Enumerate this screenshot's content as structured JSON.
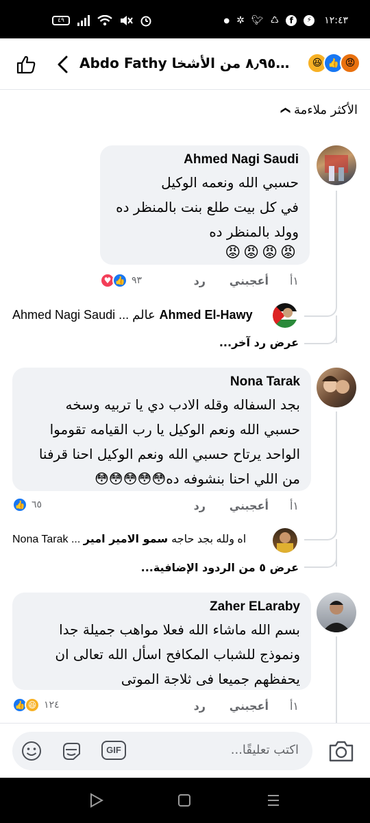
{
  "status_bar": {
    "time": "١٢:٤٣",
    "battery": "٤٩"
  },
  "header": {
    "title": "Abdo Fathy و٨٫٩٥٦ من الأشخا...",
    "reactions": [
      "angry",
      "like",
      "haha"
    ]
  },
  "sort": {
    "label": "الأكثر ملاءمة"
  },
  "comments": [
    {
      "author": "Ahmed Nagi Saudi",
      "text": "حسبي الله ونعمه الوكيل\nفي كل بيت طلع بنت بالمنظر ده\nوولد بالمنظر ده",
      "emojis": "😡😡😡😡",
      "time": "١أ",
      "like_label": "أعجبني",
      "reply_label": "رد",
      "reaction_count": "٩٣",
      "reactions": [
        "like",
        "love"
      ],
      "reply": {
        "author": "Ahmed El-Hawy",
        "snippet": "Ahmed Nagi Saudi ... عالم"
      },
      "more_replies": "عرض رد آخر..."
    },
    {
      "author": "Nona Tarak",
      "text": "بجد السفاله وقله الادب دي يا تربيه وسخه\nحسبي الله ونعم الوكيل يا رب القيامه تقوموا\nالواحد يرتاح حسبي الله ونعم الوكيل احنا قرفنا\nمن اللي احنا بنشوفه ده",
      "emojis": "😳😳😳😳😳",
      "time": "١أ",
      "like_label": "أعجبني",
      "reply_label": "رد",
      "reaction_count": "٦٥",
      "reactions": [
        "like"
      ],
      "reply": {
        "author": "سمو الامير امير",
        "snippet": "Nona Tarak ... اه ولله بجد حاجه"
      },
      "more_replies": "عرض ٥ من الردود الإضافية..."
    },
    {
      "author": "Zaher ELaraby",
      "text": "بسم الله ماشاء الله فعلا مواهب جميلة جدا\nونموذج للشباب المكافح اسأل الله تعالى ان\nيحفظهم جميعا فى ثلاجة الموتى",
      "emojis": "",
      "time": "١أ",
      "like_label": "أعجبني",
      "reply_label": "رد",
      "reaction_count": "١٢٤",
      "reactions": [
        "haha",
        "like"
      ]
    }
  ],
  "composer": {
    "placeholder": "اكتب تعليقًا...",
    "gif_label": "GIF"
  }
}
